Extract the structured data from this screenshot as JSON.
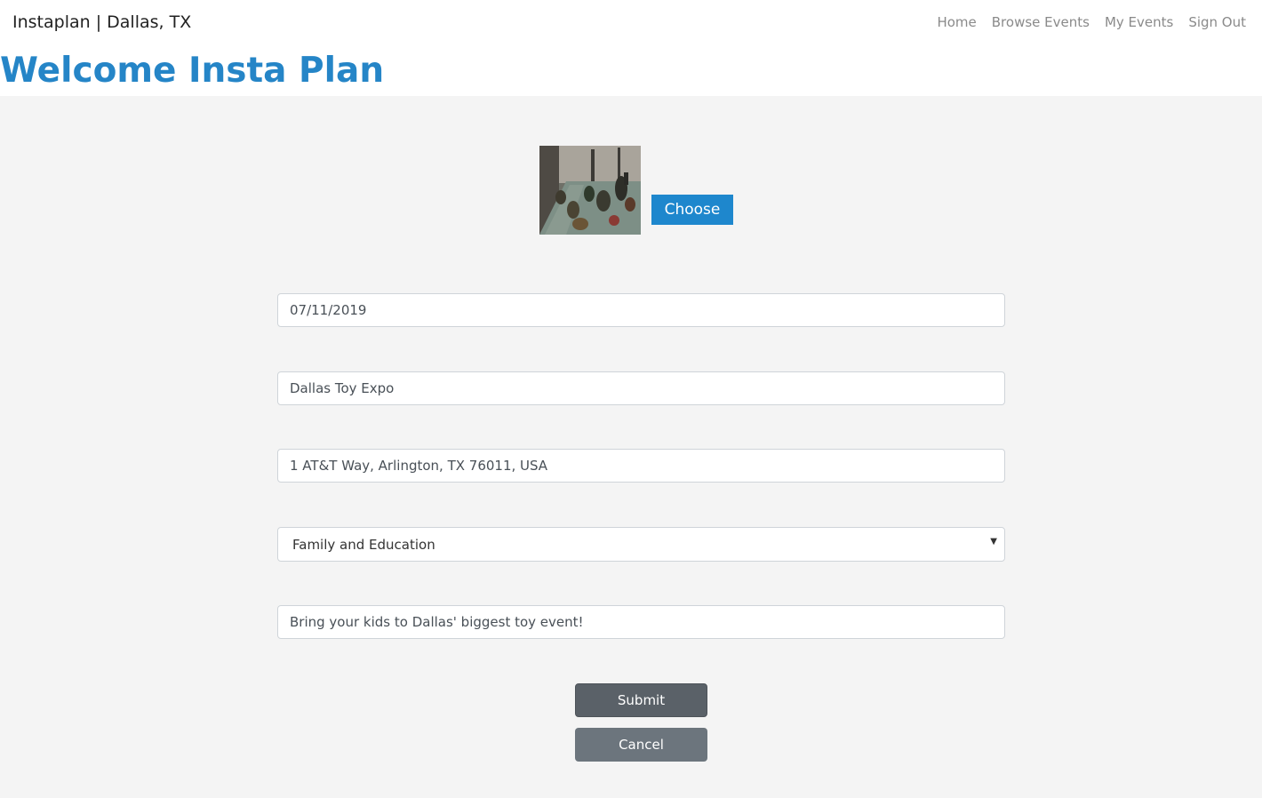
{
  "navbar": {
    "brand": "Instaplan | Dallas, TX",
    "links": [
      "Home",
      "Browse Events",
      "My Events",
      "Sign Out"
    ]
  },
  "header": {
    "title": "Welcome Insta Plan"
  },
  "form": {
    "image_alt": "event photo of toy dinosaurs",
    "choose_label": "Choose",
    "date_value": "07/11/2019",
    "name_value": "Dallas Toy Expo",
    "address_value": "1 AT&T Way, Arlington, TX 76011, USA",
    "category_value": "Family and Education",
    "description_value": "Bring your kids to Dallas' biggest toy event!",
    "submit_label": "Submit",
    "cancel_label": "Cancel"
  },
  "colors": {
    "accent": "#2585c7",
    "choose_button": "#1e87cd",
    "submit_button": "#5a6168",
    "cancel_button": "#6c757d",
    "page_background": "#f4f4f4"
  }
}
